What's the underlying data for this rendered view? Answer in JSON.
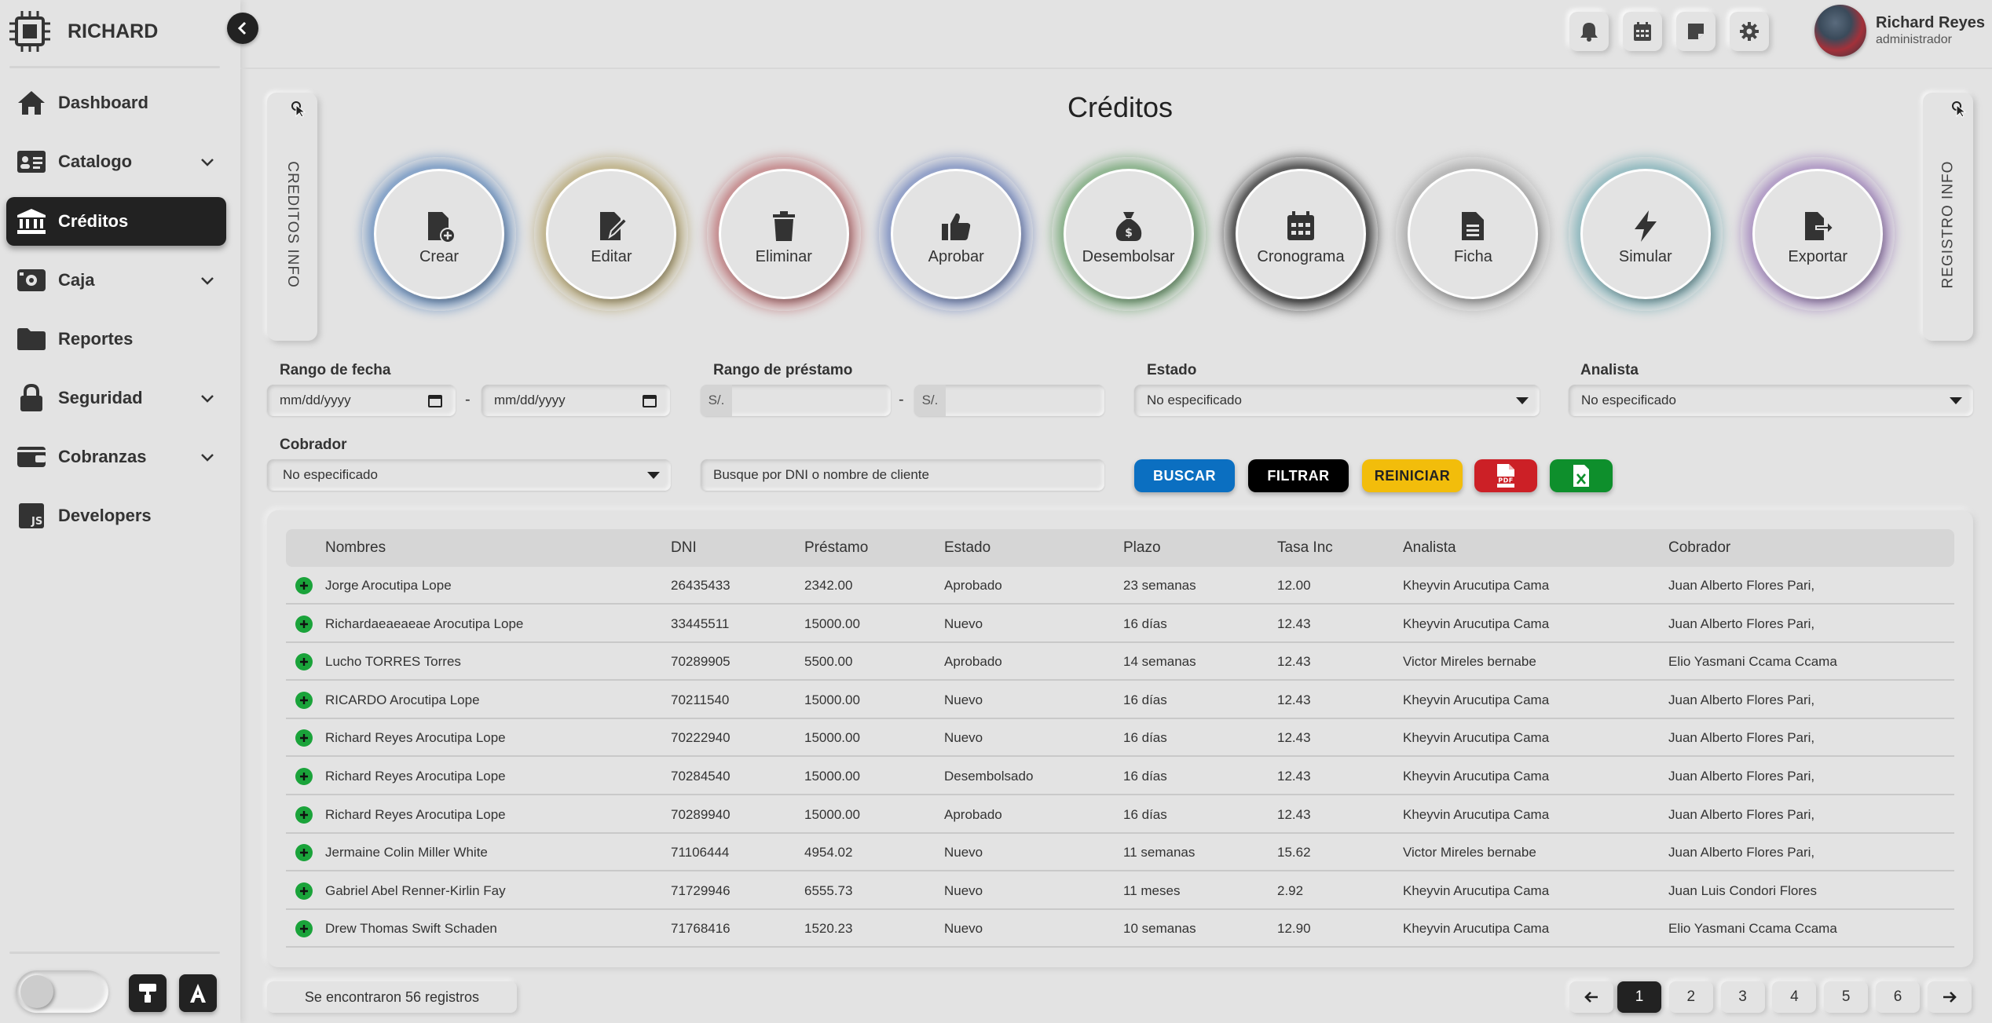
{
  "brand": {
    "name": "RICHARD"
  },
  "sidebar": {
    "items": [
      {
        "label": "Dashboard",
        "icon": "home-icon",
        "has_submenu": false,
        "active": false
      },
      {
        "label": "Catalogo",
        "icon": "id-card-icon",
        "has_submenu": true,
        "active": false
      },
      {
        "label": "Créditos",
        "icon": "bank-icon",
        "has_submenu": false,
        "active": true
      },
      {
        "label": "Caja",
        "icon": "cash-icon",
        "has_submenu": true,
        "active": false
      },
      {
        "label": "Reportes",
        "icon": "folder-icon",
        "has_submenu": false,
        "active": false
      },
      {
        "label": "Seguridad",
        "icon": "lock-icon",
        "has_submenu": true,
        "active": false
      },
      {
        "label": "Cobranzas",
        "icon": "wallet-icon",
        "has_submenu": true,
        "active": false
      },
      {
        "label": "Developers",
        "icon": "js-icon",
        "has_submenu": false,
        "active": false
      }
    ]
  },
  "user": {
    "name": "Richard Reyes",
    "role": "administrador"
  },
  "page": {
    "title": "Créditos"
  },
  "side_tabs": {
    "left": "CREDITOS INFO",
    "right": "REGISTRO INFO"
  },
  "actions": [
    {
      "label": "Crear",
      "icon": "file-plus-icon",
      "color": "#8aa6c9"
    },
    {
      "label": "Editar",
      "icon": "file-edit-icon",
      "color": "#c4b995"
    },
    {
      "label": "Eliminar",
      "icon": "trash-icon",
      "color": "#c99698"
    },
    {
      "label": "Aprobar",
      "icon": "thumbs-up-icon",
      "color": "#95a3c9"
    },
    {
      "label": "Desembolsar",
      "icon": "money-bag-icon",
      "color": "#93b794"
    },
    {
      "label": "Cronograma",
      "icon": "calendar-icon",
      "color": "#5f5f5f"
    },
    {
      "label": "Ficha",
      "icon": "file-text-icon",
      "color": "#b9b9b9"
    },
    {
      "label": "Simular",
      "icon": "bolt-icon",
      "color": "#9cbfc4"
    },
    {
      "label": "Exportar",
      "icon": "file-export-icon",
      "color": "#b5a1c8"
    }
  ],
  "filters": {
    "date_range": {
      "label": "Rango de fecha",
      "from_placeholder": "mm/dd/yyyy",
      "to_placeholder": "mm/dd/yyyy",
      "separator": "-"
    },
    "loan_range": {
      "label": "Rango de préstamo",
      "currency": "S/.",
      "separator": "-"
    },
    "estado": {
      "label": "Estado",
      "value": "No especificado"
    },
    "analista": {
      "label": "Analista",
      "value": "No especificado"
    },
    "cobrador": {
      "label": "Cobrador",
      "value": "No especificado"
    },
    "search": {
      "placeholder": "Busque por DNI o nombre de cliente"
    },
    "buttons": {
      "search": "BUSCAR",
      "filter": "FILTRAR",
      "reset": "REINICIAR",
      "pdf_text": "PDF"
    }
  },
  "table": {
    "columns": [
      "Nombres",
      "DNI",
      "Préstamo",
      "Estado",
      "Plazo",
      "Tasa Inc",
      "Analista",
      "Cobrador"
    ],
    "rows": [
      [
        "Jorge Arocutipa Lope",
        "26435433",
        "2342.00",
        "Aprobado",
        "23 semanas",
        "12.00",
        "Kheyvin Arucutipa Cama",
        "Juan Alberto Flores Pari,"
      ],
      [
        "Richardaeaeaeae Arocutipa Lope",
        "33445511",
        "15000.00",
        "Nuevo",
        "16 días",
        "12.43",
        "Kheyvin Arucutipa Cama",
        "Juan Alberto Flores Pari,"
      ],
      [
        "Lucho TORRES Torres",
        "70289905",
        "5500.00",
        "Aprobado",
        "14 semanas",
        "12.43",
        "Victor Mireles bernabe",
        "Elio Yasmani Ccama Ccama"
      ],
      [
        "RICARDO Arocutipa Lope",
        "70211540",
        "15000.00",
        "Nuevo",
        "16 días",
        "12.43",
        "Kheyvin Arucutipa Cama",
        "Juan Alberto Flores Pari,"
      ],
      [
        "Richard Reyes Arocutipa Lope",
        "70222940",
        "15000.00",
        "Nuevo",
        "16 días",
        "12.43",
        "Kheyvin Arucutipa Cama",
        "Juan Alberto Flores Pari,"
      ],
      [
        "Richard Reyes Arocutipa Lope",
        "70284540",
        "15000.00",
        "Desembolsado",
        "16 días",
        "12.43",
        "Kheyvin Arucutipa Cama",
        "Juan Alberto Flores Pari,"
      ],
      [
        "Richard Reyes Arocutipa Lope",
        "70289940",
        "15000.00",
        "Aprobado",
        "16 días",
        "12.43",
        "Kheyvin Arucutipa Cama",
        "Juan Alberto Flores Pari,"
      ],
      [
        "Jermaine Colin Miller White",
        "71106444",
        "4954.02",
        "Nuevo",
        "11 semanas",
        "15.62",
        "Victor Mireles bernabe",
        "Juan Alberto Flores Pari,"
      ],
      [
        "Gabriel Abel Renner-Kirlin Fay",
        "71729946",
        "6555.73",
        "Nuevo",
        "11 meses",
        "2.92",
        "Kheyvin Arucutipa Cama",
        "Juan Luis Condori Flores"
      ],
      [
        "Drew Thomas Swift Schaden",
        "71768416",
        "1520.23",
        "Nuevo",
        "10 semanas",
        "12.90",
        "Kheyvin Arucutipa Cama",
        "Elio Yasmani Ccama Ccama"
      ]
    ]
  },
  "footer": {
    "count_text": "Se encontraron 56 registros"
  },
  "pagination": {
    "pages": [
      "1",
      "2",
      "3",
      "4",
      "5",
      "6"
    ],
    "current": "1"
  },
  "colors": {
    "buscar": "#0b6fc1",
    "filtrar": "#000000",
    "reiniciar": "#f2bd0b",
    "pdf": "#cc2026",
    "excel": "#0e8f2c",
    "add": "#1aa33a"
  }
}
